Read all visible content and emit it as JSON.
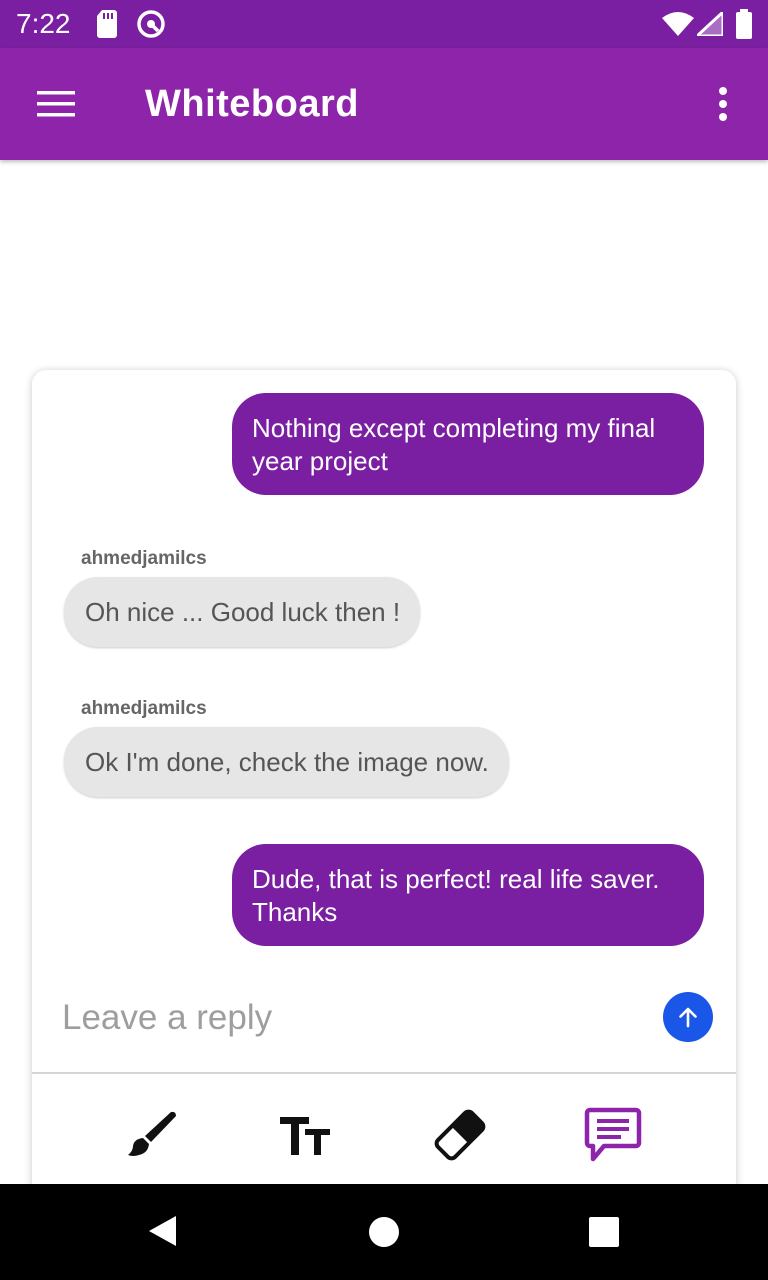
{
  "status_bar": {
    "time": "7:22",
    "icons": [
      "sd-card-icon",
      "vpn-icon",
      "wifi-icon",
      "signal-icon",
      "battery-icon"
    ]
  },
  "app_bar": {
    "title": "Whiteboard",
    "menu_icon": "hamburger-menu-icon",
    "overflow_icon": "more-vert-icon",
    "color": "#8e24aa"
  },
  "chat": {
    "messages": [
      {
        "direction": "outgoing",
        "text": "Nothing except completing my final year project"
      },
      {
        "direction": "incoming",
        "sender": "ahmedjamilcs",
        "text": "Oh nice ... Good luck then !"
      },
      {
        "direction": "incoming",
        "sender": "ahmedjamilcs",
        "text": "Ok I'm done, check the image now."
      },
      {
        "direction": "outgoing",
        "text": "Dude, that is perfect! real life saver. Thanks"
      }
    ],
    "reply_placeholder": "Leave a reply",
    "send_icon": "arrow-up-icon",
    "outgoing_color": "#7b1fa2",
    "send_color": "#1a56e8"
  },
  "toolbar": {
    "tools": [
      {
        "name": "brush",
        "icon": "brush-icon",
        "active": false
      },
      {
        "name": "text",
        "icon": "text-size-icon",
        "active": false
      },
      {
        "name": "eraser",
        "icon": "eraser-icon",
        "active": false
      },
      {
        "name": "chat",
        "icon": "chat-icon",
        "active": true
      }
    ],
    "active_color": "#8e24aa"
  },
  "nav_bar": {
    "icons": [
      "back-icon",
      "home-icon",
      "recents-icon"
    ]
  }
}
